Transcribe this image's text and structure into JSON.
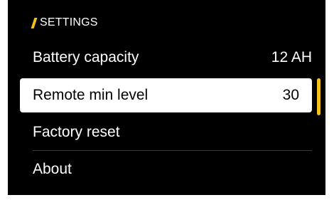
{
  "header": {
    "title": "SETTINGS",
    "accent_color": "#f2c21b"
  },
  "menu": {
    "items": [
      {
        "label": "Battery capacity",
        "value": "12 AH",
        "selected": false
      },
      {
        "label": "Remote min level",
        "value": "30",
        "selected": true
      },
      {
        "label": "Factory reset",
        "value": "",
        "selected": false
      },
      {
        "label": "About",
        "value": "",
        "selected": false
      }
    ]
  },
  "colors": {
    "background": "#000000",
    "text": "#ffffff",
    "selected_background": "#ffffff",
    "selected_text": "#000000",
    "accent": "#f2c21b"
  }
}
